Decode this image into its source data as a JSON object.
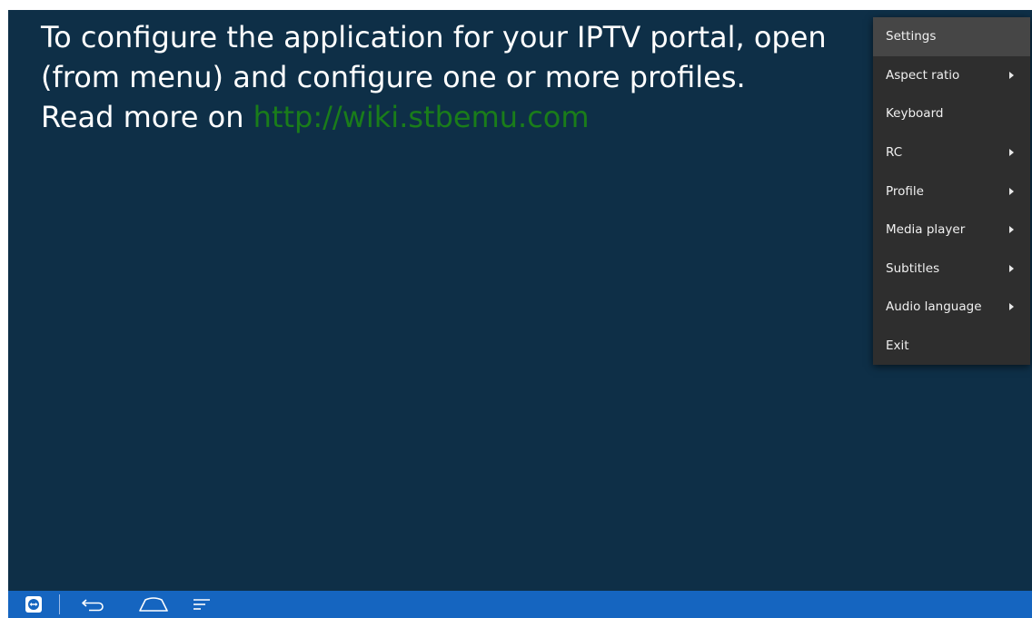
{
  "message": {
    "line1": "To configure the application for your IPTV portal, open",
    "line2": "(from menu) and configure one or more profiles.",
    "line3_prefix": "Read more on ",
    "link": "http://wiki.stbemu.com"
  },
  "menu": {
    "items": [
      {
        "label": "Settings",
        "submenu": false
      },
      {
        "label": "Aspect ratio",
        "submenu": true
      },
      {
        "label": "Keyboard",
        "submenu": false
      },
      {
        "label": "RC",
        "submenu": true
      },
      {
        "label": "Profile",
        "submenu": true
      },
      {
        "label": "Media player",
        "submenu": true
      },
      {
        "label": "Subtitles",
        "submenu": true
      },
      {
        "label": "Audio language",
        "submenu": true
      },
      {
        "label": "Exit",
        "submenu": false
      }
    ]
  },
  "navbar": {
    "icons": [
      "teamviewer-icon",
      "back-icon",
      "home-icon",
      "recent-apps-icon"
    ]
  },
  "colors": {
    "background": "#0e2f47",
    "menu": "#2e2e2e",
    "menu_highlight": "#464646",
    "link": "#1a7d1a",
    "navbar": "#1565c0"
  }
}
